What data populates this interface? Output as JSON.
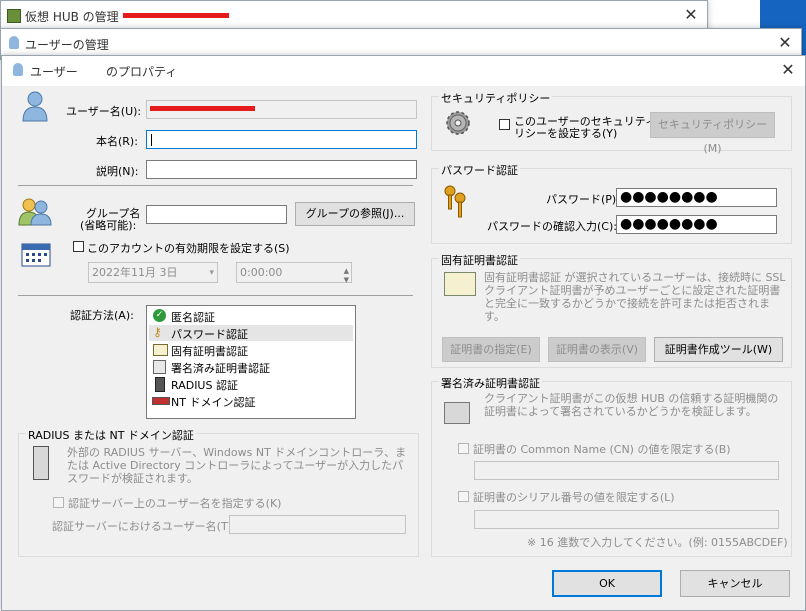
{
  "background_window": {
    "title": "仮想 HUB の管理 - ",
    "close": "✕"
  },
  "users_window": {
    "title": "ユーザーの管理",
    "close": "✕"
  },
  "dialog": {
    "title_prefix": "ユーザー",
    "title_suffix": "のプロパティ",
    "close": "✕"
  },
  "form": {
    "username_label": "ユーザー名(U):",
    "realname_label": "本名(R):",
    "realname_value": "",
    "description_label": "説明(N):",
    "description_value": "",
    "group_label_1": "グループ名",
    "group_label_2": "(省略可能):",
    "group_value": "",
    "group_browse_button": "グループの参照(J)...",
    "expire_checkbox_label": "このアカウントの有効期限を設定する(S)",
    "expire_date": "2022年11月  3日",
    "expire_time": "0:00:00",
    "auth_method_label": "認証方法(A):",
    "auth_methods": [
      "匿名認証",
      "パスワード認証",
      "固有証明書認証",
      "署名済み証明書認証",
      "RADIUS 認証",
      "NT ドメイン認証"
    ]
  },
  "radius_group": {
    "title": "RADIUS または NT ドメイン認証",
    "description": "外部の RADIUS サーバー、Windows NT ドメインコントローラ、または Active Directory コントローラによってユーザーが入力したパスワードが検証されます。",
    "specify_checkbox": "認証サーバー上のユーザー名を指定する(K)",
    "server_user_label": "認証サーバーにおけるユーザー名(T):",
    "server_user_value": ""
  },
  "security_policy": {
    "title": "セキュリティポリシー",
    "checkbox_label_1": "このユーザーのセキュリティポ",
    "checkbox_label_2": "リシーを設定する(Y)",
    "button": "セキュリティポリシー(M)"
  },
  "password_auth": {
    "title": "パスワード認証",
    "password_label": "パスワード(P):",
    "password_value": "●●●●●●●●",
    "confirm_label": "パスワードの確認入力(C):",
    "confirm_value": "●●●●●●●●"
  },
  "cert_auth": {
    "title": "固有証明書認証",
    "description": "固有証明書認証 が選択されているユーザーは、接続時に SSL クライアント証明書が予めユーザーごとに設定された証明書と完全に一致するかどうかで接続を許可または拒否されます。",
    "specify_button": "証明書の指定(E)",
    "view_button": "証明書の表示(V)",
    "tool_button": "証明書作成ツール(W)"
  },
  "signed_cert": {
    "title": "署名済み証明書認証",
    "description": "クライアント証明書がこの仮想 HUB の信頼する証明機関の証明書によって署名されているかどうかを検証します。",
    "cn_checkbox": "証明書の Common Name (CN) の値を限定する(B)",
    "cn_value": "",
    "serial_checkbox": "証明書のシリアル番号の値を限定する(L)",
    "serial_value": "",
    "hex_note": "※ 16 進数で入力してください。(例: 0155ABCDEF)"
  },
  "buttons": {
    "ok": "OK",
    "cancel": "キャンセル"
  },
  "colors": {
    "accent": "#0078d7",
    "redaction": "#e51b1b"
  }
}
